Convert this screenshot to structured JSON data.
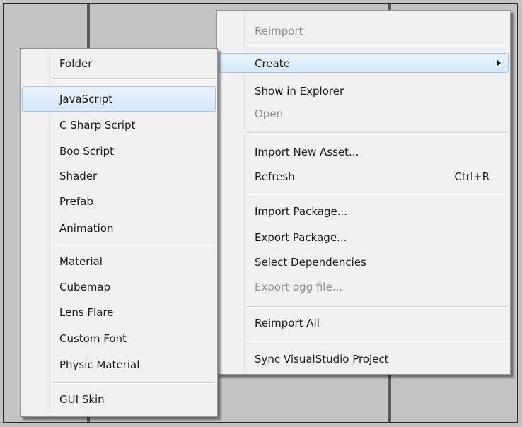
{
  "context_menu": {
    "items": [
      {
        "label": "Reimport",
        "disabled": true
      },
      {
        "label": "Create"
      },
      {
        "label": "Show in Explorer"
      },
      {
        "label": "Open",
        "disabled": true
      },
      {
        "label": "Import New Asset..."
      },
      {
        "label": "Refresh",
        "shortcut": "Ctrl+R"
      },
      {
        "label": "Import Package..."
      },
      {
        "label": "Export Package..."
      },
      {
        "label": "Select Dependencies"
      },
      {
        "label": "Export ogg file...",
        "disabled": true
      },
      {
        "label": "Reimport All"
      },
      {
        "label": "Sync VisualStudio Project"
      }
    ],
    "highlighted": "Create"
  },
  "create_submenu": {
    "items": [
      {
        "label": "Folder"
      },
      {
        "label": "JavaScript"
      },
      {
        "label": "C Sharp Script"
      },
      {
        "label": "Boo Script"
      },
      {
        "label": "Shader"
      },
      {
        "label": "Prefab"
      },
      {
        "label": "Animation"
      },
      {
        "label": "Material"
      },
      {
        "label": "Cubemap"
      },
      {
        "label": "Lens Flare"
      },
      {
        "label": "Custom Font"
      },
      {
        "label": "Physic Material"
      },
      {
        "label": "GUI Skin"
      }
    ],
    "highlighted": "JavaScript"
  },
  "colors": {
    "highlight_fill": "#d5e7f7",
    "highlight_border": "#9ec7e8",
    "disabled_text": "#8d8d8d",
    "menu_bg": "#f0f0f0"
  }
}
